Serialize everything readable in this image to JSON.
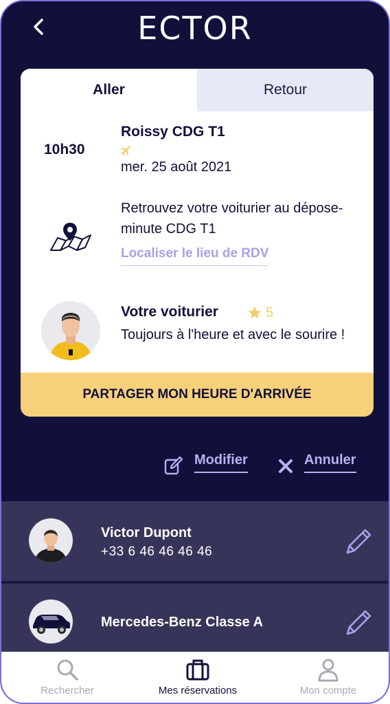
{
  "header": {
    "logo_text": "ECTOR",
    "back_icon": "chevron-left-icon"
  },
  "tabs": [
    {
      "label": "Aller",
      "active": true
    },
    {
      "label": "Retour",
      "active": false
    }
  ],
  "trip": {
    "time": "10h30",
    "destination": "Roissy CDG T1",
    "date": "mer. 25 août 2021",
    "meeting_text": "Retrouvez votre voiturier au dépose-minute CDG T1",
    "locate_link": "Localiser le lieu de RDV"
  },
  "valet": {
    "title": "Votre voiturier",
    "rating": "5",
    "description": "Toujours à l'heure et avec le sourire !"
  },
  "share_button": "PARTAGER MON HEURE D'ARRIVÉE",
  "actions": {
    "modify": "Modifier",
    "cancel": "Annuler"
  },
  "driver": {
    "name": "Victor Dupont",
    "phone": "+33 6 46 46 46 46"
  },
  "car": {
    "name": "Mercedes-Benz Classe A"
  },
  "nav": [
    {
      "label": "Rechercher",
      "icon": "search-icon"
    },
    {
      "label": "Mes réservations",
      "icon": "suitcase-icon"
    },
    {
      "label": "Mon compte",
      "icon": "user-icon"
    }
  ],
  "colors": {
    "background": "#11103a",
    "accent_yellow": "#f6d17a",
    "accent_lavender": "#b7b2f2",
    "row_background": "#363559"
  }
}
